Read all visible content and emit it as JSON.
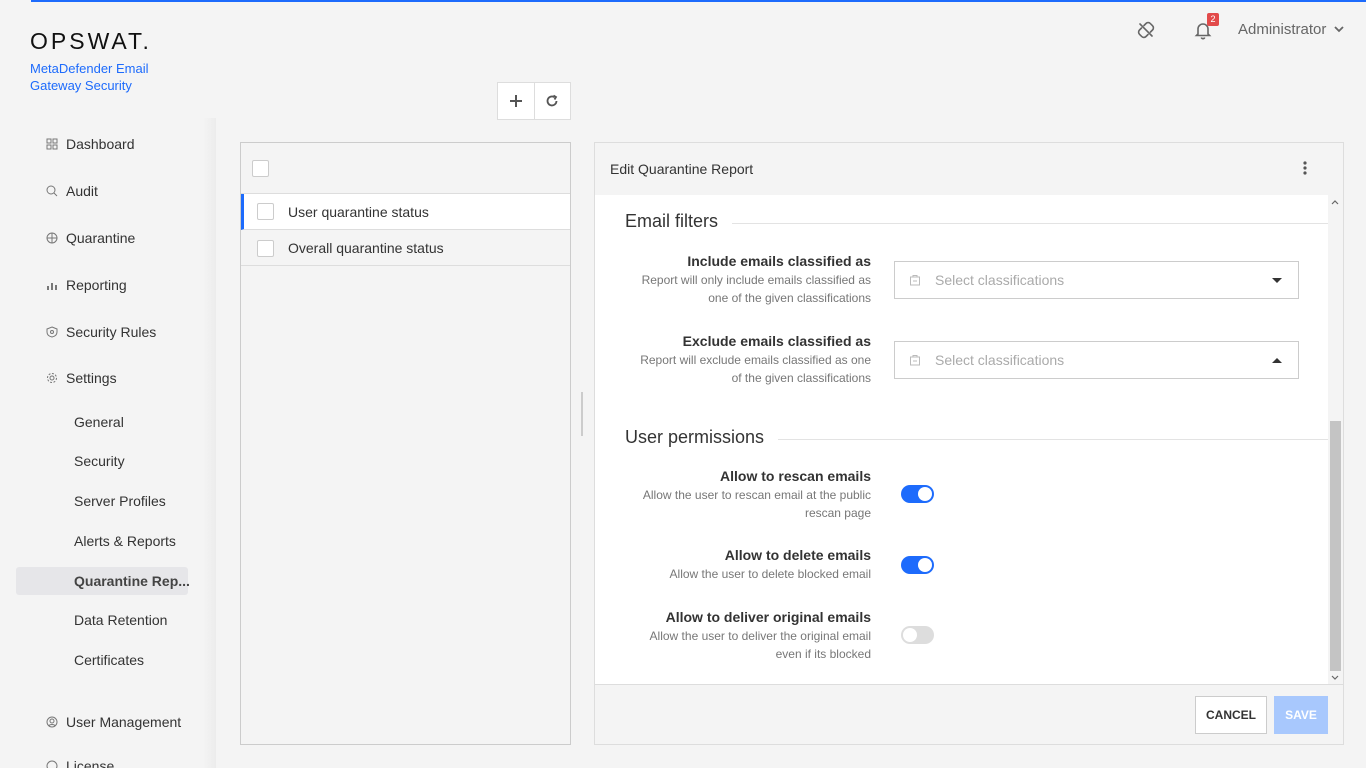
{
  "brand": {
    "logo": "OPSWAT.",
    "product_line1": "MetaDefender Email",
    "product_line2": "Gateway Security"
  },
  "topbar": {
    "notification_count": "2",
    "user_label": "Administrator"
  },
  "sidebar": {
    "items": [
      {
        "label": "Dashboard",
        "icon": "dashboard-icon"
      },
      {
        "label": "Audit",
        "icon": "audit-icon"
      },
      {
        "label": "Quarantine",
        "icon": "quarantine-icon"
      },
      {
        "label": "Reporting",
        "icon": "reporting-icon"
      },
      {
        "label": "Security Rules",
        "icon": "shield-icon"
      },
      {
        "label": "Settings",
        "icon": "gear-icon"
      }
    ],
    "settings_sub": [
      "General",
      "Security",
      "Server Profiles",
      "Alerts & Reports",
      "Quarantine Rep...",
      "Data Retention",
      "Certificates"
    ],
    "active_sub_index": 4,
    "bottom_items": [
      {
        "label": "User Management",
        "icon": "user-icon"
      },
      {
        "label": "License",
        "icon": "license-icon"
      }
    ]
  },
  "list": {
    "rows": [
      "User quarantine status",
      "Overall quarantine status"
    ]
  },
  "editor": {
    "title": "Edit Quarantine Report",
    "email_filters": {
      "heading": "Email filters",
      "include": {
        "label": "Include emails classified as",
        "desc1": "Report will only include emails classified as",
        "desc2": "one of the given classifications",
        "placeholder": "Select classifications"
      },
      "exclude": {
        "label": "Exclude emails classified as",
        "desc1": "Report will exclude emails classified as one",
        "desc2": "of the given classifications",
        "placeholder": "Select classifications"
      }
    },
    "user_permissions": {
      "heading": "User permissions",
      "rescan": {
        "label": "Allow to rescan emails",
        "desc1": "Allow the user to rescan email at the public",
        "desc2": "rescan page",
        "enabled": true
      },
      "delete": {
        "label": "Allow to delete emails",
        "desc1": "Allow the user to delete blocked email",
        "enabled": true
      },
      "deliver": {
        "label": "Allow to deliver original emails",
        "desc1": "Allow the user to deliver the original email",
        "desc2": "even if its blocked",
        "enabled": false
      }
    },
    "cancel_label": "CANCEL",
    "save_label": "SAVE"
  },
  "colors": {
    "accent": "#1d6bfc",
    "badge": "#e24a4a",
    "save_disabled": "#a8c8fd"
  }
}
